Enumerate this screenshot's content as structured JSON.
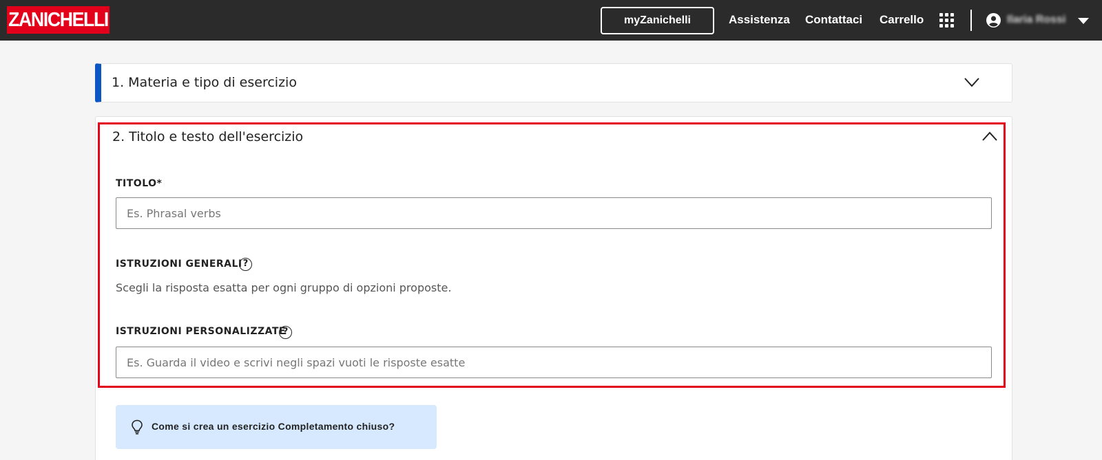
{
  "header": {
    "logo": "ZANICHELLI",
    "my_button": "myZanichelli",
    "nav": [
      "Assistenza",
      "Contattaci",
      "Carrello"
    ],
    "apps_icon": "apps-grid-icon",
    "user_icon": "user-circle-icon",
    "user_name": "Ilaria Rossi"
  },
  "sections": {
    "section1_title": "1. Materia e tipo di esercizio",
    "section2_title": "2. Titolo e testo dell'esercizio"
  },
  "form": {
    "title_label": "TITOLO*",
    "title_placeholder": "Es. Phrasal verbs",
    "general_label": "ISTRUZIONI GENERALI",
    "general_text": "Scegli la risposta esatta per ogni gruppo di opzioni proposte.",
    "custom_label": "ISTRUZIONI PERSONALIZZATE",
    "custom_placeholder": "Es. Guarda il video e scrivi negli spazi vuoti le risposte esatte",
    "help_glyph": "?"
  },
  "tip": {
    "icon": "lightbulb-icon",
    "text": "Come si crea un esercizio Completamento chiuso?"
  },
  "colors": {
    "header_bg": "#2b2b2b",
    "brand_red": "#e2001a",
    "accent_blue": "#0b56c4",
    "tip_bg": "#d6e9ff"
  }
}
